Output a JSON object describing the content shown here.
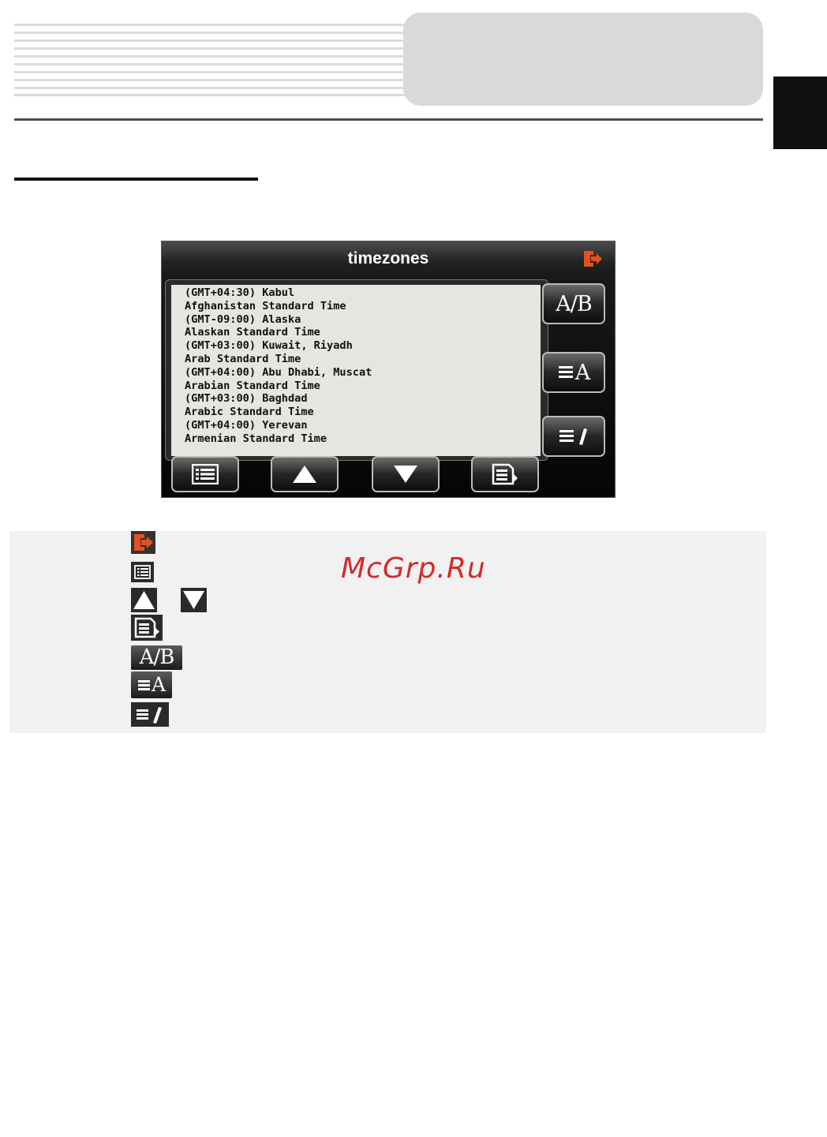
{
  "device": {
    "title": "timezones",
    "timezones": [
      "(GMT+04:30) Kabul",
      "Afghanistan Standard Time",
      "(GMT-09:00) Alaska",
      "Alaskan Standard Time",
      "(GMT+03:00) Kuwait, Riyadh",
      "Arab Standard Time",
      "(GMT+04:00) Abu Dhabi, Muscat",
      "Arabian Standard Time",
      "(GMT+03:00) Baghdad",
      "Arabic Standard Time",
      "(GMT+04:00) Yerevan",
      "Armenian Standard Time"
    ],
    "side_buttons": {
      "toggle_label": "A/B",
      "sort_letter": "A"
    },
    "icons": {
      "exit": "exit-icon",
      "list": "list-icon",
      "up": "arrow-up-icon",
      "down": "arrow-down-icon",
      "select": "select-icon",
      "toggle": "ab-toggle-icon",
      "sort": "sort-alpha-icon",
      "edit": "edit-list-icon"
    }
  },
  "legend": {
    "toggle_label": "A/B",
    "sort_letter": "A"
  },
  "watermark": "McGrp.Ru",
  "colors": {
    "accent_orange": "#e6501e",
    "screen_bg": "#e6e5e0"
  }
}
